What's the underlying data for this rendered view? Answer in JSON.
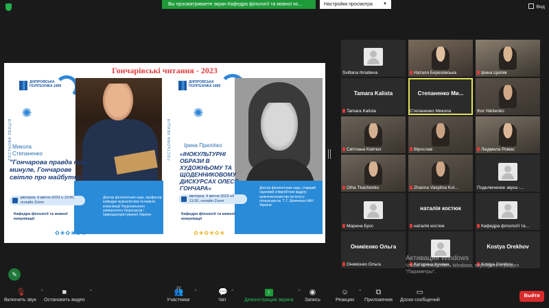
{
  "banner": {
    "text": "Вы просматриваете экран Кафедра філології та мовної ко..."
  },
  "view_options": {
    "label": "Настройки просмотра"
  },
  "view_button": {
    "label": "Вид"
  },
  "slide": {
    "title": "Гончарівські читання - 2023",
    "side_label": "ГОСТЬОВА ЛЕКЦІЯ",
    "logo_text": "ДНІПРОВСЬКА ПОЛІТЕХНІКА 1899",
    "left": {
      "speaker": "Микола Степаненко",
      "quote": "\"Гончарова правда про минуле, Гончарове світло про майбутнє\"",
      "bio": "Доктор філологічних наук, професор кафедри журналістики та мовної комунікації Національного університету біоресурсів і природокористування України",
      "date": "вівторок, 4 квітня 2023 о 10:00, онлайн Zoom",
      "dept": "Кафедра філології та мовної комунікації"
    },
    "right": {
      "speaker": "Ірина Приліпко",
      "quote": "«ІНОКУЛЬТУРНІ ОБРАЗИ В ХУДОЖНЬОМУ ТА ЩОДЕННИКОВОМУ ДИСКУРСАХ ОЛЕСЯ ГОНЧАРА»",
      "bio": "Доктор філологічних наук, старший науковий співробітник відділу шевченкознавства Інституту літератури ім. Т. Г. Шевченка НАН України",
      "date": "вівторок, 4 квітня 2023 об 11:00, онлайн Zoom",
      "dept": "Кафедра філології та мовної комунікації"
    }
  },
  "participants": [
    {
      "name": "Svitlana Ihnatieva",
      "type": "avatar",
      "muted": false
    },
    {
      "name": "Наталя Березовська",
      "type": "video",
      "muted": true
    },
    {
      "name": "Ірина Цюпяк",
      "type": "video",
      "muted": true
    },
    {
      "name": "Tamara Kalista",
      "big": "Tamara Kalista",
      "type": "name",
      "muted": true
    },
    {
      "name": "Степаненко Микола",
      "big": "Степаненко Ми...",
      "type": "name",
      "muted": false,
      "selected": true
    },
    {
      "name": "Ihor Nikitenko",
      "type": "video",
      "muted": false
    },
    {
      "name": "Світлана Ковтюх",
      "type": "video",
      "muted": true
    },
    {
      "name": "Вірослав",
      "type": "video",
      "muted": true
    },
    {
      "name": "Людмила Ромас",
      "type": "video",
      "muted": true
    },
    {
      "name": "Olha Tkachenko",
      "type": "video",
      "muted": true
    },
    {
      "name": "Zhanna Vasylina Kol...",
      "type": "video",
      "muted": true
    },
    {
      "name": "Подключение звука -...",
      "type": "avatar",
      "muted": false
    },
    {
      "name": "Марина Бусс",
      "type": "avatar",
      "muted": true
    },
    {
      "name": "наталія костюк",
      "big": "наталія костюк",
      "type": "name",
      "muted": true
    },
    {
      "name": "Кафедра філології та...",
      "type": "avatar",
      "muted": true
    },
    {
      "name": "Оникієнко Ольга",
      "big": "Оникієнко Ольга",
      "type": "name",
      "muted": true
    },
    {
      "name": "Катерина Кучмак",
      "type": "avatar",
      "muted": true
    },
    {
      "name": "Kostya Orekhov",
      "big": "Kostya Orekhov",
      "type": "name",
      "muted": true
    }
  ],
  "windows_activation": {
    "title": "Активация Windows",
    "subtitle": "Чтобы активировать Windows, перейдите в раздел \"Параметры\"."
  },
  "toolbar": {
    "mute": "Включить звук",
    "video": "Остановить видео",
    "participants": "Участники",
    "participants_count": "22",
    "chat": "Чат",
    "share": "Демонстрация экрана",
    "record": "Запись",
    "reactions": "Реакции",
    "apps": "Приложения",
    "whiteboard": "Доски сообщений",
    "leave": "Выйти"
  },
  "colors": {
    "accent_green": "#1f9a3a",
    "leave_red": "#d92b2b",
    "slide_blue": "#2a8bd8",
    "title_red": "#e33b3b"
  }
}
